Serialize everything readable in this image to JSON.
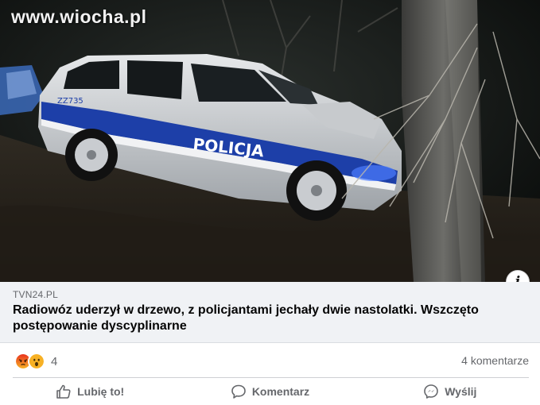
{
  "photo": {
    "watermark": "www.wiocha.pl",
    "car_door_text": "POLICJA",
    "car_number": "ZZ735",
    "info_icon": "info-icon"
  },
  "link_preview": {
    "source": "TVN24.PL",
    "headline": "Radiowóz uderzył w drzewo, z policjantami jechały dwie nastolatki. Wszczęto postępowanie dyscyplinarne"
  },
  "stats": {
    "reaction_icons": [
      "angry-icon",
      "wow-icon"
    ],
    "reaction_count": "4",
    "comments": "4 komentarze"
  },
  "actions": {
    "like": "Lubię to!",
    "comment": "Komentarz",
    "share": "Wyślij"
  },
  "colors": {
    "link_box_bg": "#f0f2f5",
    "secondary_text": "#65676b",
    "angry": "#e9710f",
    "wow": "#f7b125",
    "police_blue": "#1d3fa8"
  }
}
